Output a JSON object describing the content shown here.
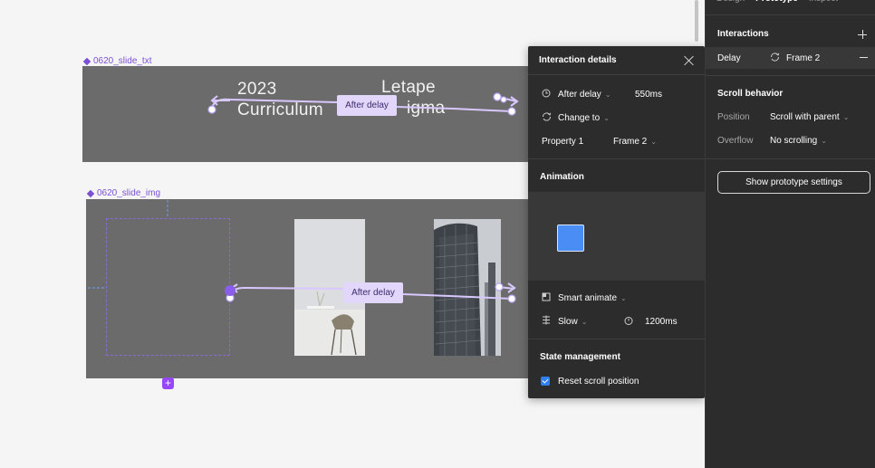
{
  "canvas": {
    "frames": [
      {
        "label": "0620_slide_txt"
      },
      {
        "label": "0620_slide_img"
      }
    ],
    "slide_text": {
      "line1_a": "2023",
      "line2_a": "Curriculum",
      "line1_b": "Letape",
      "line2_b": "igma"
    },
    "chips": {
      "txt_delay": "After delay",
      "img_delay": "After delay"
    },
    "add_badge": "+"
  },
  "popover": {
    "title": "Interaction details",
    "trigger": {
      "label": "After delay",
      "value": "550ms"
    },
    "action": {
      "label": "Change to"
    },
    "property": {
      "label": "Property 1",
      "value": "Frame 2"
    },
    "animation_title": "Animation",
    "animation_type": "Smart animate",
    "easing": "Slow",
    "duration": "1200ms",
    "state_title": "State management",
    "reset_scroll": "Reset scroll position",
    "colors": {
      "preview_square": "#4a8ef5",
      "checkbox": "#2f80ed"
    }
  },
  "panel": {
    "tabs": [
      "Design",
      "Prototype",
      "Inspect"
    ],
    "interactions_title": "Interactions",
    "interaction": {
      "trigger": "Delay",
      "destination": "Frame 2"
    },
    "scroll_title": "Scroll behavior",
    "position": {
      "label": "Position",
      "value": "Scroll with parent"
    },
    "overflow": {
      "label": "Overflow",
      "value": "No scrolling"
    },
    "settings_button": "Show prototype settings",
    "colors": {
      "accent": "#9747ff",
      "flow": "#d9c8ff"
    }
  }
}
